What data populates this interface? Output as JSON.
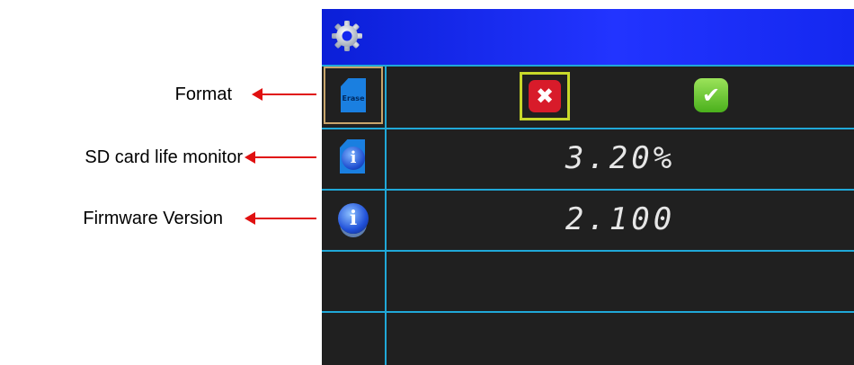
{
  "annotations": {
    "format": "Format",
    "sd_life": "SD card life monitor",
    "firmware": "Firmware Version"
  },
  "screen": {
    "title_icon": "gear-icon",
    "format_row": {
      "icon": "sd-card-erase-icon",
      "icon_text": "Erase",
      "cancel_icon": "x-icon",
      "cancel_symbol": "✖",
      "confirm_icon": "check-icon",
      "confirm_symbol": "✔"
    },
    "sd_life_row": {
      "icon": "sd-card-info-icon",
      "value": "3.20%"
    },
    "firmware_row": {
      "icon": "info-icon",
      "value": "2.100"
    }
  },
  "colors": {
    "title_bar": "#1428f0",
    "grid_lines": "#20a8d8",
    "screen_bg": "#202020",
    "annotation_arrow": "#e01010",
    "cancel_red": "#d81b2a",
    "confirm_green": "#4ab01c",
    "selection_yellow": "#c8d82a"
  }
}
